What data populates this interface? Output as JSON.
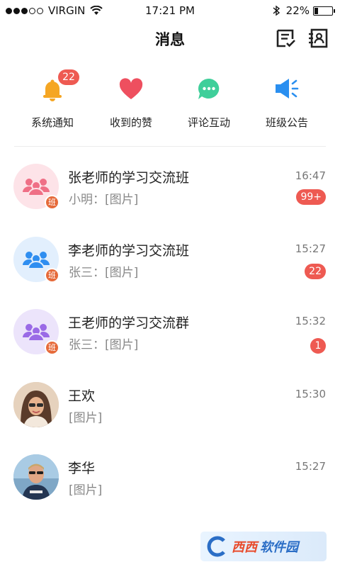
{
  "status_bar": {
    "carrier": "VIRGIN",
    "time": "17:21 PM",
    "battery": "22%",
    "battery_level": 0.22
  },
  "nav": {
    "title": "消息",
    "left_action_icon": "edit-list-icon",
    "right_action_icon": "contacts-icon"
  },
  "quick_entries": [
    {
      "label": "系统通知",
      "icon": "bell-icon",
      "color": "#f5a623",
      "badge": "22"
    },
    {
      "label": "收到的赞",
      "icon": "heart-icon",
      "color": "#ee4f5f",
      "badge": ""
    },
    {
      "label": "评论互动",
      "icon": "comment-icon",
      "color": "#3fcf9a",
      "badge": ""
    },
    {
      "label": "班级公告",
      "icon": "megaphone-icon",
      "color": "#2a8ff0",
      "badge": ""
    }
  ],
  "conversations": [
    {
      "name": "张老师的学习交流班",
      "preview": "小明：[图片]",
      "time": "16:47",
      "unread": "99+",
      "is_class": true,
      "tag": "班",
      "avatar_bg": "#fde3e8",
      "avatar_color": "#ef6f86"
    },
    {
      "name": "李老师的学习交流班",
      "preview": "张三：[图片]",
      "time": "15:27",
      "unread": "22",
      "is_class": true,
      "tag": "班",
      "avatar_bg": "#e2effd",
      "avatar_color": "#2f8ef0"
    },
    {
      "name": "王老师的学习交流群",
      "preview": "张三：[图片]",
      "time": "15:32",
      "unread": "1",
      "is_class": true,
      "tag": "班",
      "avatar_bg": "#ece4fb",
      "avatar_color": "#9a6ae6"
    },
    {
      "name": "王欢",
      "preview": "[图片]",
      "time": "15:30",
      "unread": "",
      "is_class": false,
      "avatar_bg": "#d8c3ad",
      "avatar_color": "#5a3b2a"
    },
    {
      "name": "李华",
      "preview": "[图片]",
      "time": "15:27",
      "unread": "",
      "is_class": false,
      "avatar_bg": "#9fc3df",
      "avatar_color": "#1f2f4a"
    }
  ],
  "watermark": {
    "text1": "西西",
    "text2": "软件园"
  }
}
